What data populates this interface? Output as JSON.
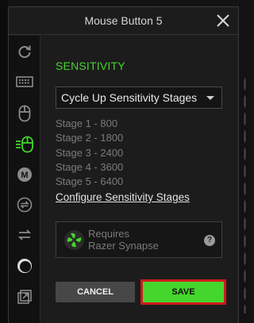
{
  "window": {
    "title": "Mouse Button 5"
  },
  "sidebar": {
    "items": [
      {
        "icon": "refresh-icon"
      },
      {
        "icon": "keyboard-icon"
      },
      {
        "icon": "mouse-icon"
      },
      {
        "icon": "sensitivity-icon",
        "active": true
      },
      {
        "icon": "macro-icon"
      },
      {
        "icon": "switch-profile-icon"
      },
      {
        "icon": "swap-icon"
      },
      {
        "icon": "chroma-icon"
      },
      {
        "icon": "launch-program-icon"
      }
    ],
    "macro_letter": "M"
  },
  "main": {
    "section_title": "SENSITIVITY",
    "dropdown": {
      "selected": "Cycle Up Sensitivity Stages"
    },
    "stages": [
      "Stage 1 - 800",
      "Stage 2 - 1800",
      "Stage 3 - 2400",
      "Stage 4 - 3600",
      "Stage 5 - 6400"
    ],
    "configure_link": "Configure Sensitivity Stages",
    "synapse_notice": {
      "line1": "Requires",
      "line2": "Razer Synapse",
      "help": "?"
    }
  },
  "buttons": {
    "cancel": "CANCEL",
    "save": "SAVE"
  },
  "colors": {
    "accent": "#44d62c",
    "highlight": "#d11a1a"
  }
}
